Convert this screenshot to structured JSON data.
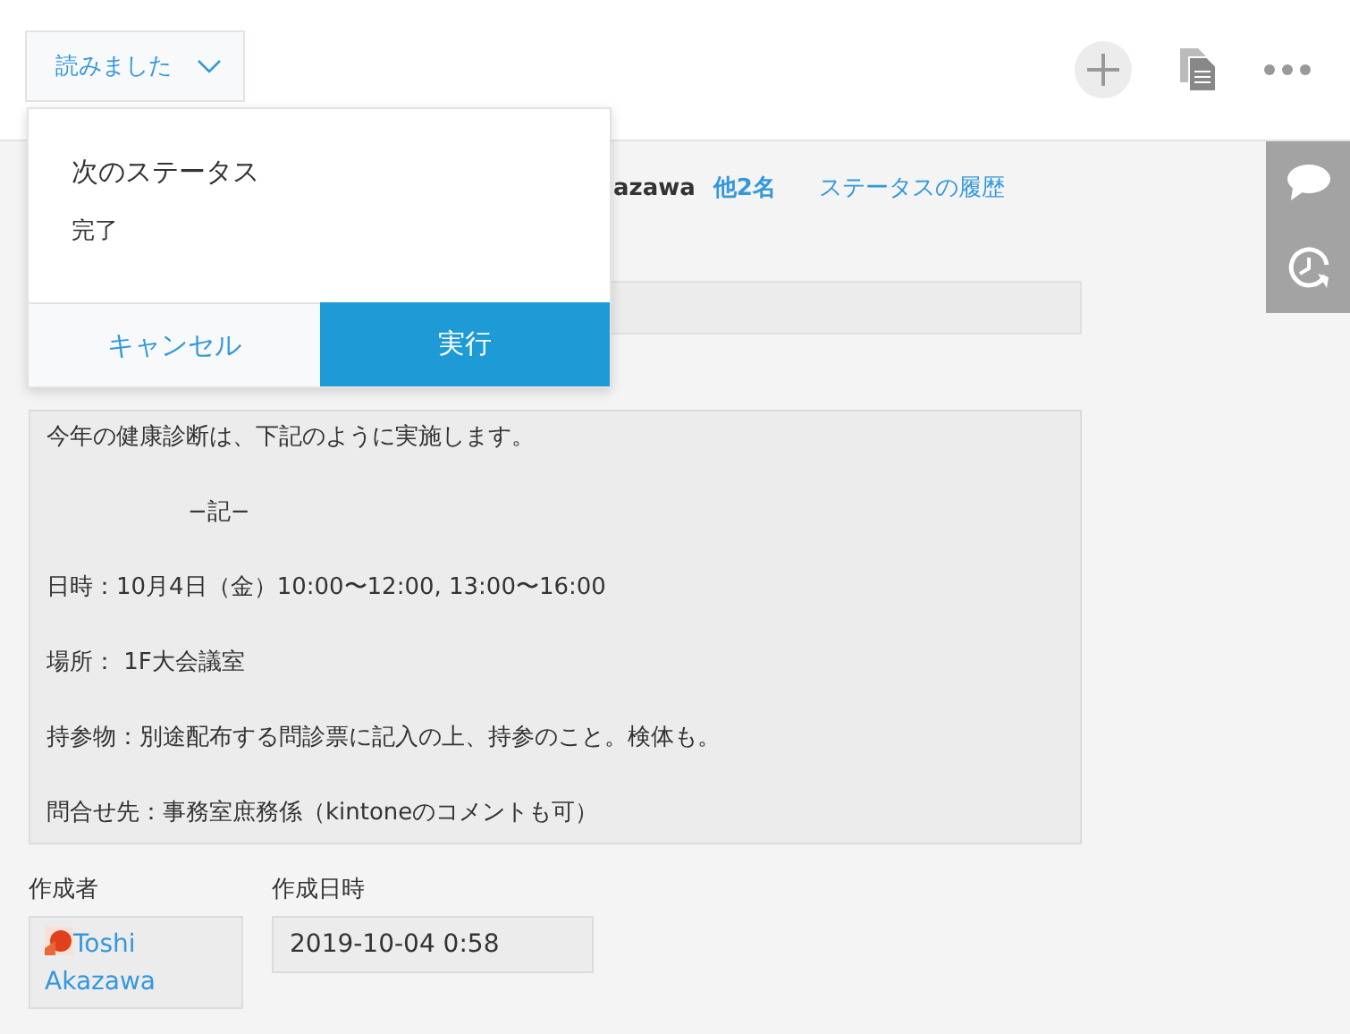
{
  "toolbar": {
    "action_button": "読みました"
  },
  "status_popover": {
    "title": "次のステータス",
    "next_status": "完了",
    "cancel_button": "キャンセル",
    "run_button": "実行"
  },
  "assignee": {
    "name": "azawa",
    "others_link": "他2名",
    "history_link": "ステータスの履歴"
  },
  "content_lines": [
    {
      "text": "今年の健康診断は、下記のように実施します。",
      "kind": "line"
    },
    {
      "kind": "blank"
    },
    {
      "text": "−記−",
      "kind": "center"
    },
    {
      "kind": "blank"
    },
    {
      "text": "日時：10月4日（金）10:00〜12:00, 13:00〜16:00",
      "kind": "line"
    },
    {
      "kind": "blank"
    },
    {
      "text": "場所： 1F大会議室",
      "kind": "line"
    },
    {
      "kind": "blank"
    },
    {
      "text": "持参物：別途配布する問診票に記入の上、持参のこと。検体も。",
      "kind": "line"
    },
    {
      "kind": "blank"
    },
    {
      "text": "問合せ先：事務室庶務係（kintoneのコメントも可）",
      "kind": "line"
    }
  ],
  "creator": {
    "label": "作成者",
    "first_name": "Toshi",
    "last_name": "Akazawa"
  },
  "created_at": {
    "label": "作成日時",
    "value": "2019-10-04 0:58"
  }
}
